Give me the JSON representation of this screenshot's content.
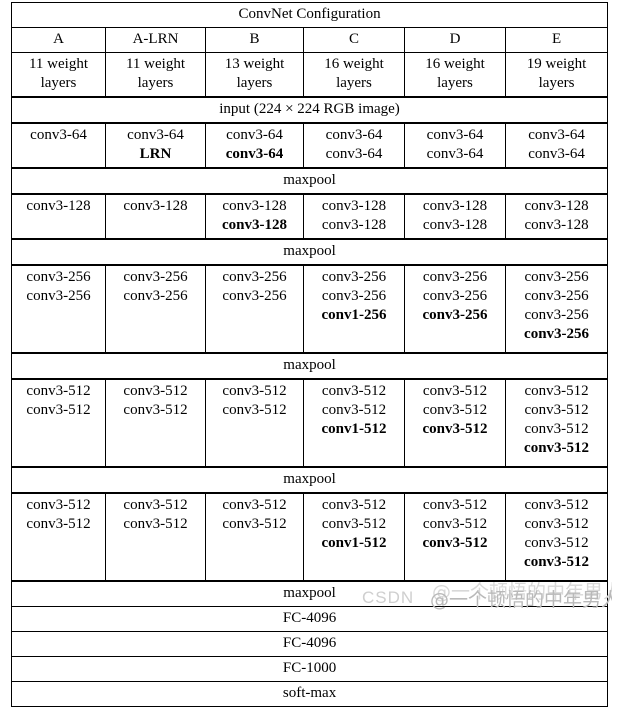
{
  "table": {
    "title": "ConvNet Configuration",
    "columns": [
      {
        "name": "A",
        "weights_line1": "11 weight",
        "weights_line2": "layers"
      },
      {
        "name": "A-LRN",
        "weights_line1": "11 weight",
        "weights_line2": "layers"
      },
      {
        "name": "B",
        "weights_line1": "13 weight",
        "weights_line2": "layers"
      },
      {
        "name": "C",
        "weights_line1": "16 weight",
        "weights_line2": "layers"
      },
      {
        "name": "D",
        "weights_line1": "16 weight",
        "weights_line2": "layers"
      },
      {
        "name": "E",
        "weights_line1": "19 weight",
        "weights_line2": "layers"
      }
    ],
    "input_row": "input (224 × 224 RGB image)",
    "maxpool_label": "maxpool",
    "blocks": [
      {
        "id": "block-64",
        "cells": [
          {
            "layers": [
              {
                "text": "conv3-64",
                "bold": false
              }
            ]
          },
          {
            "layers": [
              {
                "text": "conv3-64",
                "bold": false
              },
              {
                "text": "LRN",
                "bold": true
              }
            ]
          },
          {
            "layers": [
              {
                "text": "conv3-64",
                "bold": false
              },
              {
                "text": "conv3-64",
                "bold": true
              }
            ]
          },
          {
            "layers": [
              {
                "text": "conv3-64",
                "bold": false
              },
              {
                "text": "conv3-64",
                "bold": false
              }
            ]
          },
          {
            "layers": [
              {
                "text": "conv3-64",
                "bold": false
              },
              {
                "text": "conv3-64",
                "bold": false
              }
            ]
          },
          {
            "layers": [
              {
                "text": "conv3-64",
                "bold": false
              },
              {
                "text": "conv3-64",
                "bold": false
              }
            ]
          }
        ]
      },
      {
        "id": "block-128",
        "cells": [
          {
            "layers": [
              {
                "text": "conv3-128",
                "bold": false
              }
            ]
          },
          {
            "layers": [
              {
                "text": "conv3-128",
                "bold": false
              }
            ]
          },
          {
            "layers": [
              {
                "text": "conv3-128",
                "bold": false
              },
              {
                "text": "conv3-128",
                "bold": true
              }
            ]
          },
          {
            "layers": [
              {
                "text": "conv3-128",
                "bold": false
              },
              {
                "text": "conv3-128",
                "bold": false
              }
            ]
          },
          {
            "layers": [
              {
                "text": "conv3-128",
                "bold": false
              },
              {
                "text": "conv3-128",
                "bold": false
              }
            ]
          },
          {
            "layers": [
              {
                "text": "conv3-128",
                "bold": false
              },
              {
                "text": "conv3-128",
                "bold": false
              }
            ]
          }
        ]
      },
      {
        "id": "block-256",
        "cells": [
          {
            "layers": [
              {
                "text": "conv3-256",
                "bold": false
              },
              {
                "text": "conv3-256",
                "bold": false
              }
            ]
          },
          {
            "layers": [
              {
                "text": "conv3-256",
                "bold": false
              },
              {
                "text": "conv3-256",
                "bold": false
              }
            ]
          },
          {
            "layers": [
              {
                "text": "conv3-256",
                "bold": false
              },
              {
                "text": "conv3-256",
                "bold": false
              }
            ]
          },
          {
            "layers": [
              {
                "text": "conv3-256",
                "bold": false
              },
              {
                "text": "conv3-256",
                "bold": false
              },
              {
                "text": "conv1-256",
                "bold": true
              }
            ]
          },
          {
            "layers": [
              {
                "text": "conv3-256",
                "bold": false
              },
              {
                "text": "conv3-256",
                "bold": false
              },
              {
                "text": "conv3-256",
                "bold": true
              }
            ]
          },
          {
            "layers": [
              {
                "text": "conv3-256",
                "bold": false
              },
              {
                "text": "conv3-256",
                "bold": false
              },
              {
                "text": "conv3-256",
                "bold": false
              },
              {
                "text": "conv3-256",
                "bold": true
              }
            ]
          }
        ]
      },
      {
        "id": "block-512-a",
        "cells": [
          {
            "layers": [
              {
                "text": "conv3-512",
                "bold": false
              },
              {
                "text": "conv3-512",
                "bold": false
              }
            ]
          },
          {
            "layers": [
              {
                "text": "conv3-512",
                "bold": false
              },
              {
                "text": "conv3-512",
                "bold": false
              }
            ]
          },
          {
            "layers": [
              {
                "text": "conv3-512",
                "bold": false
              },
              {
                "text": "conv3-512",
                "bold": false
              }
            ]
          },
          {
            "layers": [
              {
                "text": "conv3-512",
                "bold": false
              },
              {
                "text": "conv3-512",
                "bold": false
              },
              {
                "text": "conv1-512",
                "bold": true
              }
            ]
          },
          {
            "layers": [
              {
                "text": "conv3-512",
                "bold": false
              },
              {
                "text": "conv3-512",
                "bold": false
              },
              {
                "text": "conv3-512",
                "bold": true
              }
            ]
          },
          {
            "layers": [
              {
                "text": "conv3-512",
                "bold": false
              },
              {
                "text": "conv3-512",
                "bold": false
              },
              {
                "text": "conv3-512",
                "bold": false
              },
              {
                "text": "conv3-512",
                "bold": true
              }
            ]
          }
        ]
      },
      {
        "id": "block-512-b",
        "cells": [
          {
            "layers": [
              {
                "text": "conv3-512",
                "bold": false
              },
              {
                "text": "conv3-512",
                "bold": false
              }
            ]
          },
          {
            "layers": [
              {
                "text": "conv3-512",
                "bold": false
              },
              {
                "text": "conv3-512",
                "bold": false
              }
            ]
          },
          {
            "layers": [
              {
                "text": "conv3-512",
                "bold": false
              },
              {
                "text": "conv3-512",
                "bold": false
              }
            ]
          },
          {
            "layers": [
              {
                "text": "conv3-512",
                "bold": false
              },
              {
                "text": "conv3-512",
                "bold": false
              },
              {
                "text": "conv1-512",
                "bold": true
              }
            ]
          },
          {
            "layers": [
              {
                "text": "conv3-512",
                "bold": false
              },
              {
                "text": "conv3-512",
                "bold": false
              },
              {
                "text": "conv3-512",
                "bold": true
              }
            ]
          },
          {
            "layers": [
              {
                "text": "conv3-512",
                "bold": false
              },
              {
                "text": "conv3-512",
                "bold": false
              },
              {
                "text": "conv3-512",
                "bold": false
              },
              {
                "text": "conv3-512",
                "bold": true
              }
            ]
          }
        ]
      }
    ],
    "tail_rows": [
      "maxpool",
      "FC-4096",
      "FC-4096",
      "FC-1000",
      "soft-max"
    ]
  },
  "watermark": {
    "site": "CSDN",
    "handle": "@一个顿悟的中年男人"
  }
}
